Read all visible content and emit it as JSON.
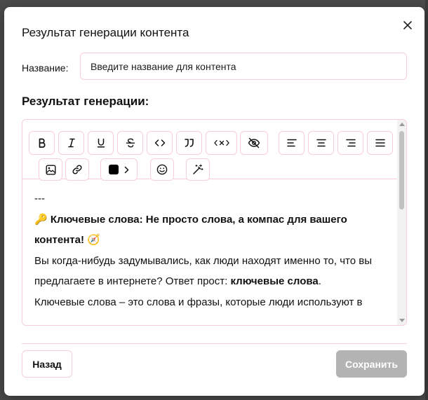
{
  "dialog": {
    "title": "Результат генерации контента",
    "name_label": "Название:",
    "name_placeholder": "Введите название для контента",
    "name_value": "",
    "result_heading": "Результат генерации:"
  },
  "toolbar": {
    "icons": [
      "bold-icon",
      "italic-icon",
      "underline-icon",
      "strikethrough-icon",
      "code-icon",
      "quote-icon",
      "code-block-icon",
      "hide-icon",
      "align-left-icon",
      "align-center-icon",
      "align-right-icon",
      "align-justify-icon",
      "image-icon",
      "link-icon",
      "text-color-icon",
      "emoji-icon",
      "magic-wand-icon"
    ],
    "text_color": "#000000"
  },
  "editor": {
    "separator": "---",
    "heading_emoji": "🔑",
    "heading_text": "Ключевые слова: Не просто слова, а компас для вашего контента!",
    "heading_emoji_end": "🧭",
    "p1_text": "Вы когда-нибудь задумывались, как люди находят именно то, что вы предлагаете в интернете? Ответ прост: ",
    "p1_bold": "ключевые слова",
    "p1_end": ".",
    "p2_text": "Ключевые слова – это слова и фразы, которые люди используют в"
  },
  "footer": {
    "back_label": "Назад",
    "save_label": "Сохранить"
  },
  "colors": {
    "border_accent": "#f6cfd8",
    "save_disabled": "#b3b3b3"
  }
}
